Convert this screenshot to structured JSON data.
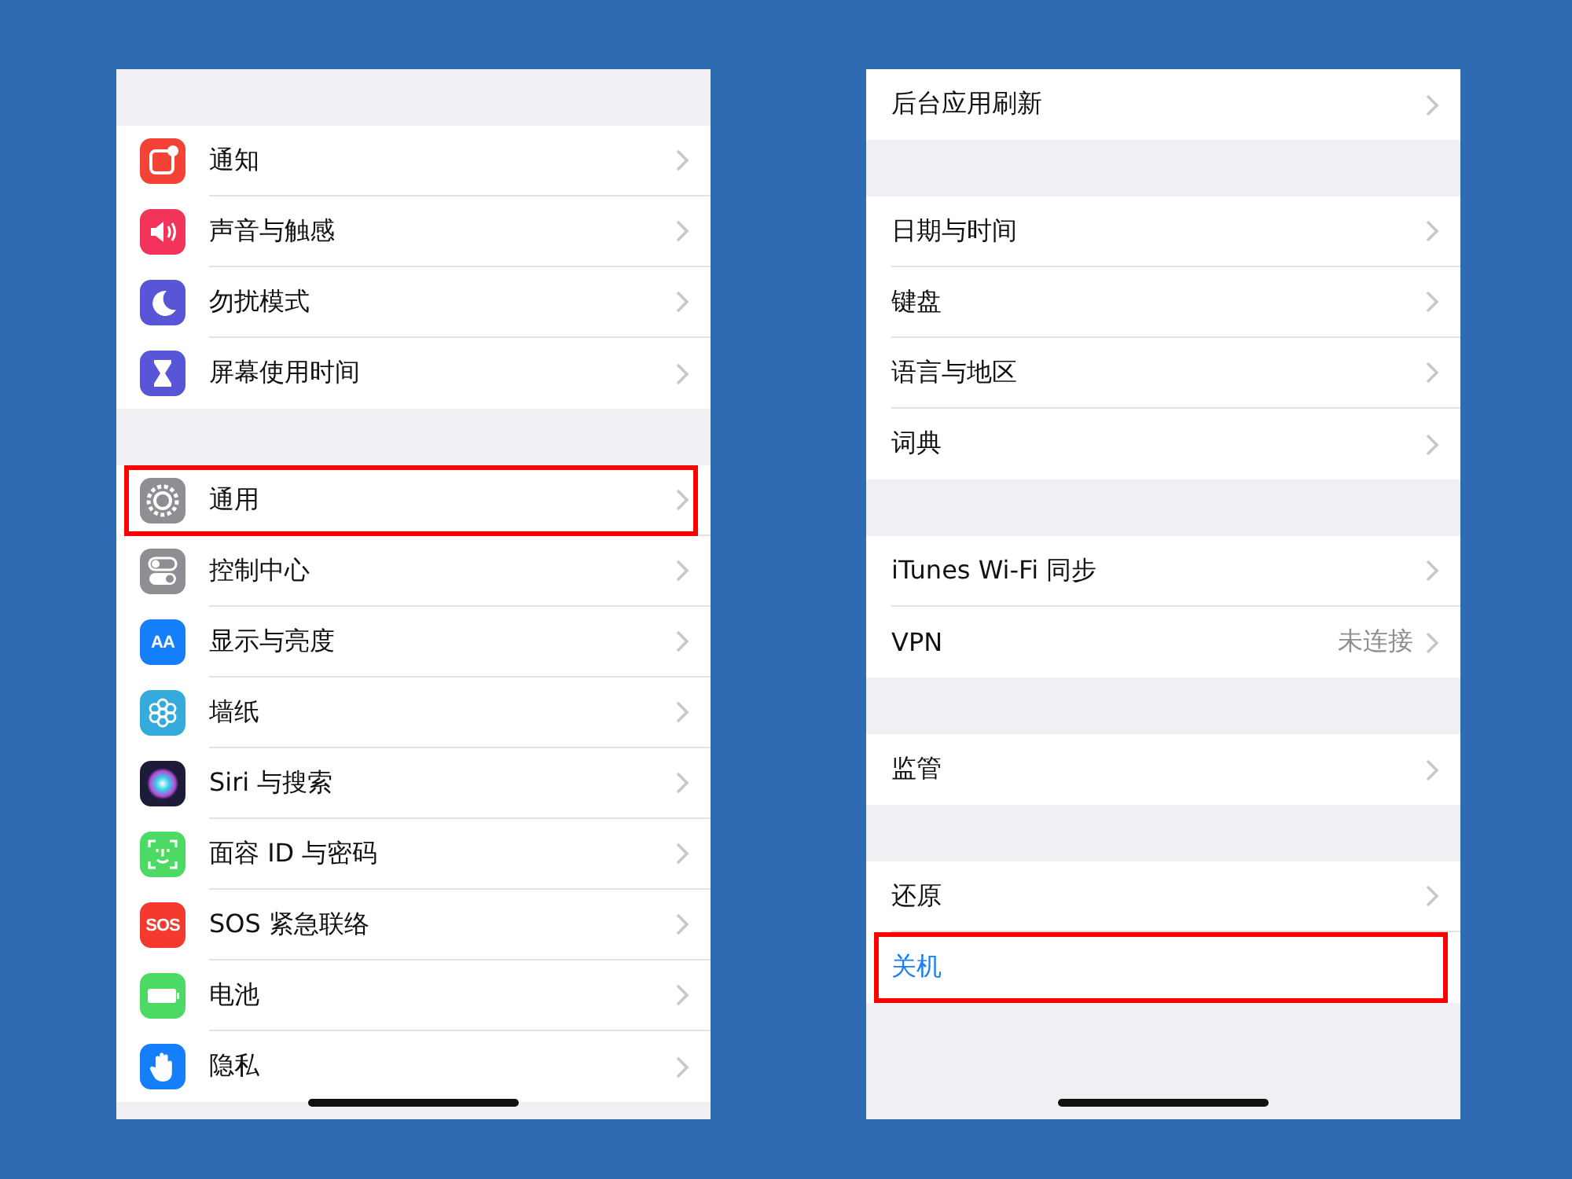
{
  "panels": [
    {
      "sections": [
        {
          "rows": [
            {
              "label": "通知",
              "kind": "notify",
              "color": "#f44336",
              "chevron": true,
              "highlighted": false
            },
            {
              "label": "声音与触感",
              "kind": "sound",
              "color": "#f2335a",
              "chevron": true,
              "highlighted": false
            },
            {
              "label": "勿扰模式",
              "kind": "moon",
              "color": "#5856d6",
              "chevron": true,
              "highlighted": false
            },
            {
              "label": "屏幕使用时间",
              "kind": "hourglass",
              "color": "#5856d6",
              "chevron": true,
              "highlighted": false
            }
          ]
        },
        {
          "rows": [
            {
              "label": "通用",
              "kind": "gear",
              "color": "#8e8e93",
              "chevron": true,
              "highlighted": true
            },
            {
              "label": "控制中心",
              "kind": "toggles",
              "color": "#8e8e93",
              "chevron": true,
              "highlighted": false
            },
            {
              "label": "显示与亮度",
              "kind": "glyph",
              "glyph": "AA",
              "color": "#147efb",
              "chevron": true,
              "highlighted": false
            },
            {
              "label": "墙纸",
              "kind": "flower",
              "color": "#35aadc",
              "chevron": true,
              "highlighted": false
            },
            {
              "label": "Siri 与搜索",
              "kind": "orb",
              "color": "#1c1c3a",
              "chevron": true,
              "highlighted": false
            },
            {
              "label": "面容 ID 与密码",
              "kind": "face",
              "color": "#4cd964",
              "chevron": true,
              "highlighted": false
            },
            {
              "label": "SOS 紧急联络",
              "kind": "glyph",
              "glyph": "SOS",
              "color": "#f43a2f",
              "chevron": true,
              "highlighted": false
            },
            {
              "label": "电池",
              "kind": "battery",
              "color": "#4cd964",
              "chevron": true,
              "highlighted": false
            },
            {
              "label": "隐私",
              "kind": "hand",
              "color": "#147efb",
              "chevron": true,
              "highlighted": false
            }
          ]
        }
      ]
    },
    {
      "sections": [
        {
          "rows": [
            {
              "label": "后台应用刷新",
              "chevron": true,
              "highlighted": false
            }
          ]
        },
        {
          "rows": [
            {
              "label": "日期与时间",
              "chevron": true,
              "highlighted": false
            },
            {
              "label": "键盘",
              "chevron": true,
              "highlighted": false
            },
            {
              "label": "语言与地区",
              "chevron": true,
              "highlighted": false
            },
            {
              "label": "词典",
              "chevron": true,
              "highlighted": false
            }
          ]
        },
        {
          "rows": [
            {
              "label": "iTunes Wi-Fi 同步",
              "chevron": true,
              "highlighted": false
            },
            {
              "label": "VPN",
              "value": "未连接",
              "chevron": true,
              "highlighted": false
            }
          ]
        },
        {
          "rows": [
            {
              "label": "监管",
              "chevron": true,
              "highlighted": false
            }
          ]
        },
        {
          "rows": [
            {
              "label": "还原",
              "chevron": true,
              "highlighted": false
            },
            {
              "label": "关机",
              "kind": "action",
              "chevron": false,
              "highlighted": true
            }
          ]
        }
      ]
    }
  ]
}
